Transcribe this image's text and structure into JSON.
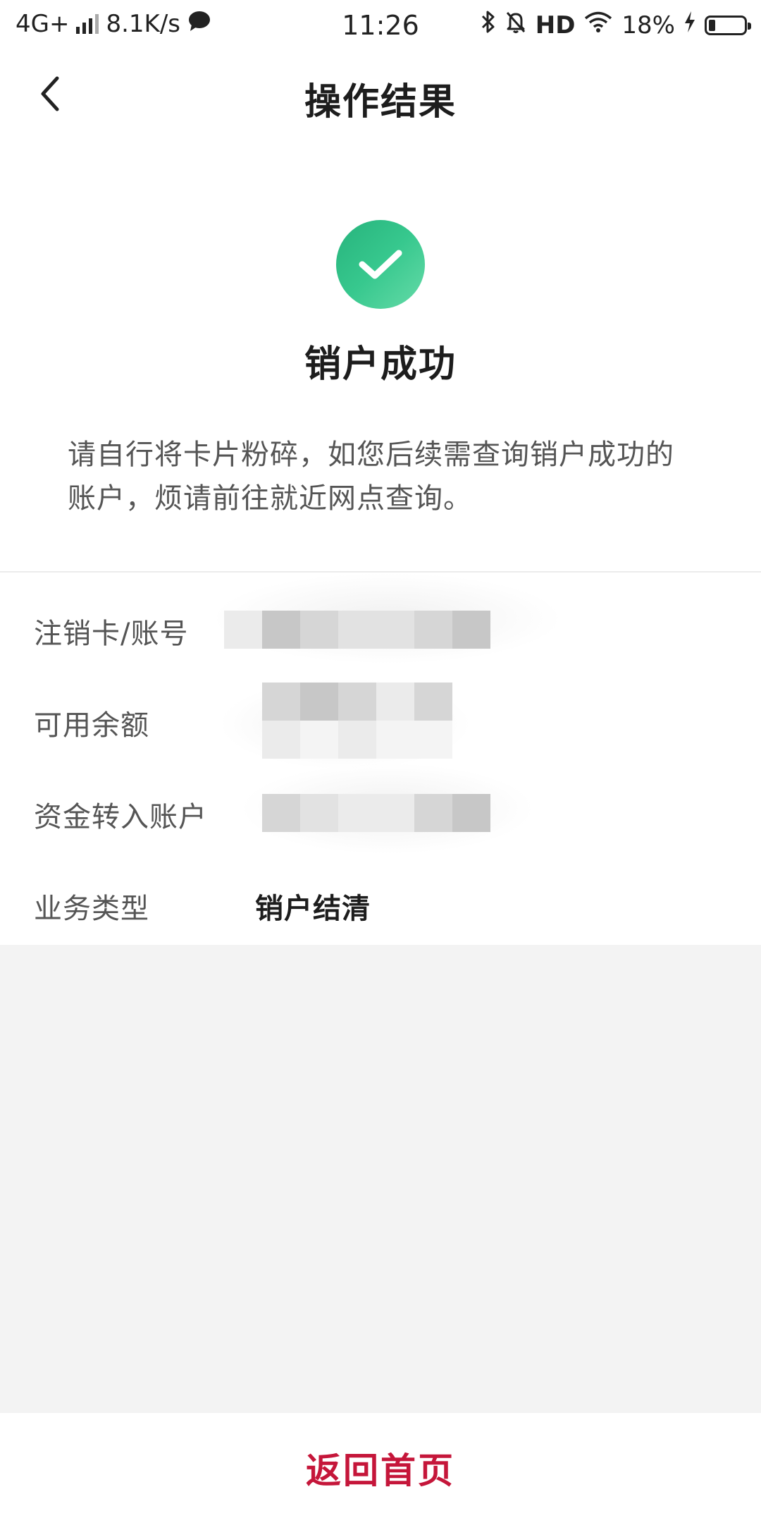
{
  "status_bar": {
    "network": "4G+",
    "speed": "8.1K/s",
    "time": "11:26",
    "hd": "HD",
    "battery_percent": "18%",
    "battery_level": 0.18,
    "icons": [
      "signal-icon",
      "chat-bubble-icon",
      "bluetooth-icon",
      "bell-off-icon",
      "wifi-icon",
      "charging-icon",
      "battery-icon"
    ]
  },
  "nav": {
    "title": "操作结果",
    "back_icon": "chevron-left-icon"
  },
  "result": {
    "icon": "check-circle-icon",
    "icon_color": "#2dbd84",
    "title": "销户成功",
    "message": "请自行将卡片粉碎，如您后续需查询销户成功的账户，烦请前往就近网点查询。"
  },
  "details": [
    {
      "label": "注销卡/账号",
      "value": ""
    },
    {
      "label": "可用余额",
      "value": ""
    },
    {
      "label": "资金转入账户",
      "value": ""
    },
    {
      "label": "业务类型",
      "value": "销户结清"
    }
  ],
  "footer": {
    "home_label": "返回首页",
    "accent_color": "#c5163a"
  }
}
